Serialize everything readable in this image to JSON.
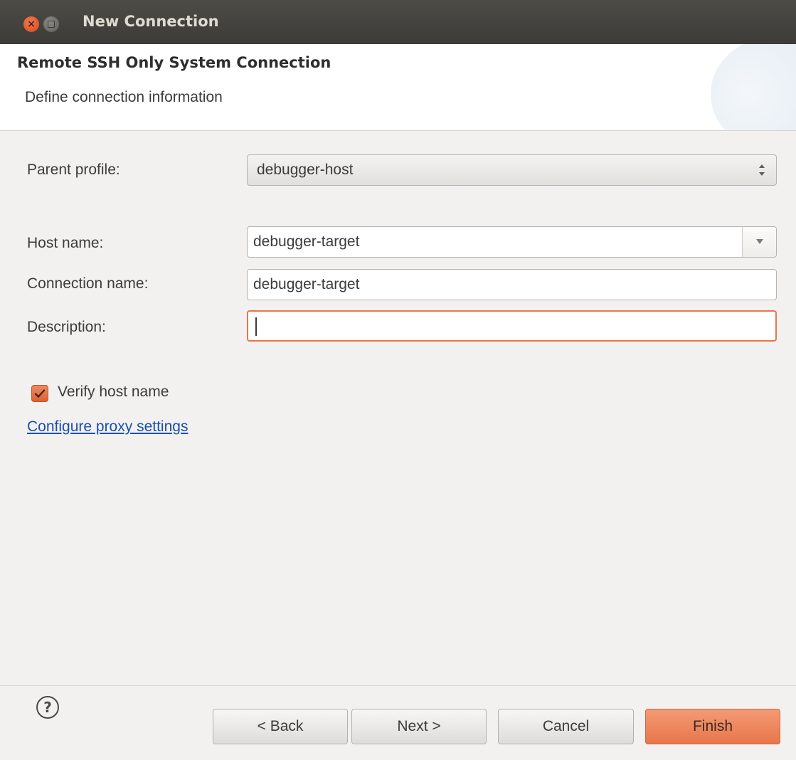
{
  "window": {
    "title": "New Connection",
    "close_glyph": "×"
  },
  "header": {
    "title": "Remote SSH Only System Connection",
    "subtitle": "Define connection information"
  },
  "form": {
    "parent_profile": {
      "label": "Parent profile:",
      "value": "debugger-host"
    },
    "host_name": {
      "label": "Host name:",
      "value": "debugger-target"
    },
    "connection_name": {
      "label": "Connection name:",
      "value": "debugger-target"
    },
    "description": {
      "label": "Description:",
      "value": ""
    },
    "verify_host": {
      "label": "Verify host name",
      "checked": true
    },
    "proxy_link": "Configure proxy settings"
  },
  "footer": {
    "help_glyph": "?",
    "back_label": "< Back",
    "next_label": "Next >",
    "cancel_label": "Cancel",
    "finish_label": "Finish"
  },
  "colors": {
    "accent": "#e8764a",
    "link": "#1a4fae",
    "titlebar": "#3c3b37"
  }
}
